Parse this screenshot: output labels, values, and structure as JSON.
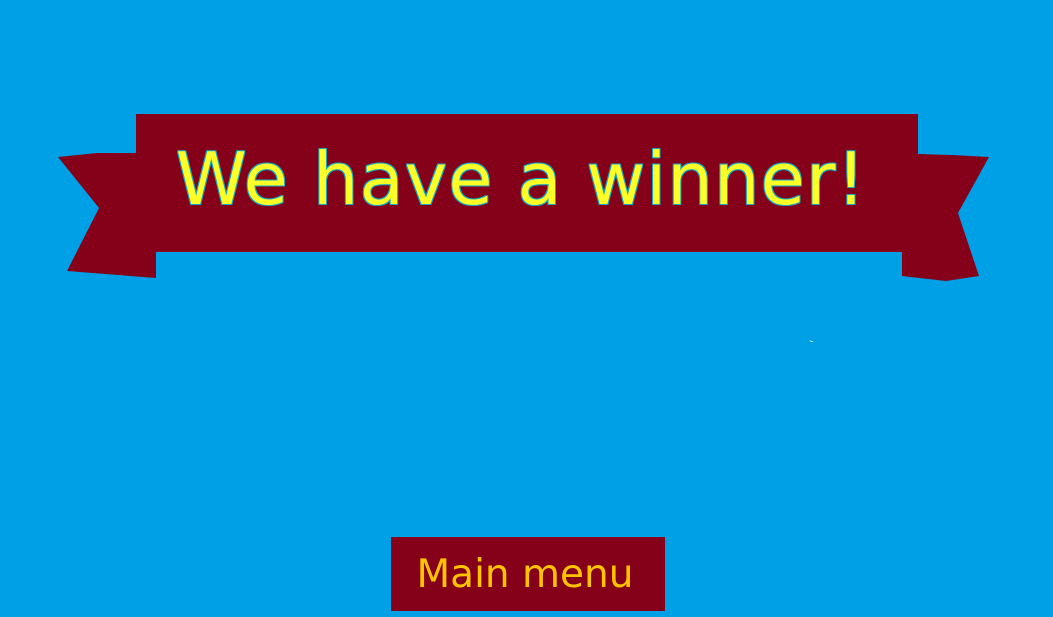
{
  "screen": {
    "title": "We have a winner!",
    "main_menu_label": "Main menu"
  },
  "colors": {
    "background": "#00a0e6",
    "ribbon": "#850019",
    "title_text": "#ffff28",
    "button_text": "#ffc300"
  },
  "icons": {
    "ribbon": "ribbon-banner-icon",
    "cursor": "small-cursor-mark"
  }
}
